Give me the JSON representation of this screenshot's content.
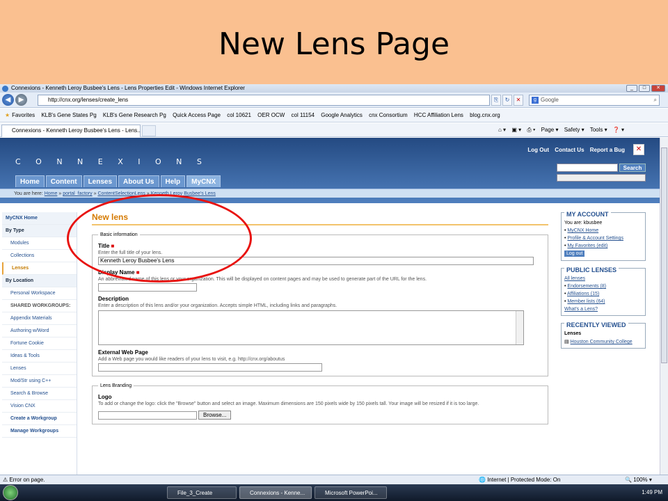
{
  "slide": {
    "title": "New Lens Page"
  },
  "browser": {
    "window_title": "Connexions - Kenneth Leroy Busbee's Lens - Lens Properties Edit - Windows Internet Explorer",
    "address": "http://cnx.org/lenses/create_lens",
    "search_placeholder": "Google",
    "favorites_label": "Favorites",
    "favorites": [
      "KLB's Gene States Pg",
      "KLB's Gene Research Pg",
      "Quick Access Page",
      "col 10621",
      "OER OCW",
      "col 11154",
      "Google Analytics",
      "cnx Consortium",
      "HCC Affiliation Lens",
      "blog.cnx.org"
    ],
    "tab_title": "Connexions - Kenneth Leroy Busbee's Lens - Lens...",
    "commands": {
      "page": "Page ▾",
      "safety": "Safety ▾",
      "tools": "Tools ▾"
    }
  },
  "cnx": {
    "logo_text": "C O N N E X I O N S",
    "toplinks": [
      "Log Out",
      "Contact Us",
      "Report a Bug"
    ],
    "search_button": "Search",
    "nav_tabs": [
      "Home",
      "Content",
      "Lenses",
      "About Us",
      "Help",
      "MyCNX"
    ],
    "breadcrumb": {
      "prefix": "You are here:",
      "items": [
        "Home",
        "portal_factory",
        "ContentSelectionLens",
        "Kenneth Leroy Busbee's Lens"
      ]
    }
  },
  "sidebar": {
    "mycnx_home": "MyCNX Home",
    "by_type": "By Type",
    "types": [
      "Modules",
      "Collections",
      "Lenses"
    ],
    "by_location": "By Location",
    "personal_workspace": "Personal Workspace",
    "shared_workgroups": "SHARED WORKGROUPS:",
    "workgroups": [
      "Appendix Materials",
      "Authoring w/Word",
      "Fortune Cookie",
      "Ideas & Tools",
      "Lenses",
      "Mod/Str using C++",
      "Search & Browse",
      "Vision CNX"
    ],
    "create_workgroup": "Create a Workgroup",
    "manage_workgroups": "Manage Workgroups"
  },
  "form": {
    "heading": "New lens",
    "basic_legend": "Basic information",
    "title_label": "Title",
    "title_help": "Enter the full title of your lens.",
    "title_value": "Kenneth Leroy Busbee's Lens",
    "display_label": "Display Name",
    "display_help": "An abbreviated name of this lens or your organization. This will be displayed on content pages and may be used to generate part of the URL for the lens.",
    "description_label": "Description",
    "description_help": "Enter a description of this lens and/or your organization. Accepts simple HTML, including links and paragraphs.",
    "external_label": "External Web Page",
    "external_help": "Add a Web page you would like readers of your lens to visit, e.g. http://cnx.org/aboutus",
    "branding_legend": "Lens Branding",
    "logo_label": "Logo",
    "logo_help": "To add or change the logo: click the \"Browse\" button and select an image. Maximum dimensions are 150 pixels wide by 150 pixels tall. Your image will be resized if it is too large.",
    "browse_label": "Browse..."
  },
  "account": {
    "heading": "MY ACCOUNT",
    "you_are": "You are: kbusbee",
    "links": [
      "MyCNX Home",
      "Profile & Account Settings",
      "My Favorites (edit)"
    ],
    "logout": "Log out"
  },
  "public_lenses": {
    "heading": "PUBLIC LENSES",
    "all": "All lenses",
    "items": [
      "Endorsements (8)",
      "Affiliations (15)",
      "Member lists (64)"
    ],
    "whats": "What's a Lens?"
  },
  "recent": {
    "heading": "RECENTLY VIEWED",
    "sub": "Lenses",
    "item": "Houston Community College"
  },
  "status": {
    "left": "Error on page.",
    "zone": "Internet | Protected Mode: On",
    "zoom": "100%"
  },
  "taskbar": {
    "items": [
      "File_3_Create",
      "Connexions - Kenne...",
      "Microsoft PowerPoi..."
    ],
    "time": "1:49 PM"
  }
}
